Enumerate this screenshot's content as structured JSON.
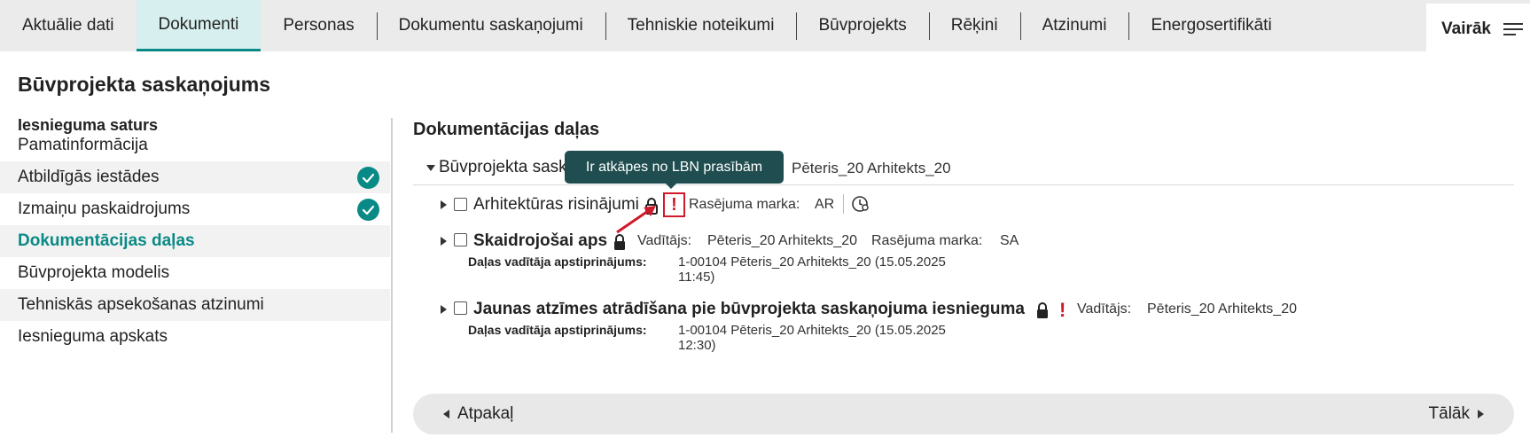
{
  "tabs": [
    {
      "label": "Aktuālie dati",
      "active": false
    },
    {
      "label": "Dokumenti",
      "active": true
    },
    {
      "label": "Personas",
      "active": false
    },
    {
      "label": "Dokumentu saskaņojumi",
      "active": false
    },
    {
      "label": "Tehniskie noteikumi",
      "active": false
    },
    {
      "label": "Būvprojekts",
      "active": false
    },
    {
      "label": "Rēķini",
      "active": false
    },
    {
      "label": "Atzinumi",
      "active": false
    },
    {
      "label": "Energosertifikāti",
      "active": false
    }
  ],
  "more_label": "Vairāk",
  "page_title": "Būvprojekta saskaņojums",
  "sidebar": {
    "heading": "Iesnieguma saturs",
    "items": [
      {
        "label": "Pamatinformācija",
        "checked": false,
        "active": false
      },
      {
        "label": "Atbildīgās iestādes",
        "checked": true,
        "active": false
      },
      {
        "label": "Izmaiņu paskaidrojums",
        "checked": true,
        "active": false
      },
      {
        "label": "Dokumentācijas daļas",
        "checked": false,
        "active": true
      },
      {
        "label": "Būvprojekta modelis",
        "checked": false,
        "active": false
      },
      {
        "label": "Tehniskās apsekošanas atzinumi",
        "checked": false,
        "active": false
      },
      {
        "label": "Iesnieguma apskats",
        "checked": false,
        "active": false
      }
    ]
  },
  "main": {
    "section_title": "Dokumentācijas daļas",
    "group": {
      "title": "Būvprojekta sask",
      "person": "Pēteris_20 Arhitekts_20"
    },
    "tooltip": "Ir atkāpes no LBN prasībām",
    "rows": [
      {
        "title": "Arhitektūras risinājumi",
        "warn_icon": "!",
        "mark_label": "Rasējuma marka:",
        "mark_value": "AR"
      },
      {
        "title": "Skaidrojošai aps",
        "leader_label": "Vadītājs:",
        "leader_value": "Pēteris_20 Arhitekts_20",
        "mark_label": "Rasējuma marka:",
        "mark_value": "SA",
        "approval_label": "Daļas vadītāja apstiprinājums:",
        "approval_value": "1-00104 Pēteris_20 Arhitekts_20 (15.05.2025 11:45)"
      },
      {
        "title": "Jaunas atzīmes atrādīšana pie būvprojekta saskaņojuma iesnieguma",
        "warn_icon": "!",
        "leader_label": "Vadītājs:",
        "leader_value": "Pēteris_20 Arhitekts_20",
        "approval_label": "Daļas vadītāja apstiprinājums:",
        "approval_value": "1-00104 Pēteris_20 Arhitekts_20 (15.05.2025 12:30)"
      }
    ]
  },
  "footer": {
    "back_label": "Atpakaļ",
    "next_label": "Tālāk"
  },
  "colors": {
    "accent": "#0a8a86",
    "active_tab_bg": "#d7efee",
    "warning": "#d0192a",
    "tooltip_bg": "#204d4f"
  }
}
